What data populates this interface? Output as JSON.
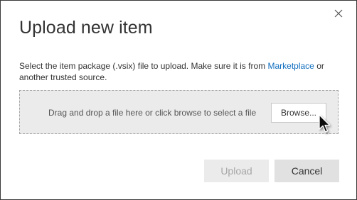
{
  "dialog": {
    "title": "Upload new item",
    "close_icon": "close-icon",
    "description_prefix": "Select the item package (.vsix) file to upload. Make sure it is from ",
    "description_link": "Marketplace",
    "description_suffix": " or another trusted source.",
    "dropzone_text": "Drag and drop a file here or click browse to select a file",
    "browse_label": "Browse...",
    "upload_label": "Upload",
    "cancel_label": "Cancel"
  },
  "colors": {
    "link": "#106ebe",
    "dropzone_bg": "#ebebeb",
    "border": "#3a3a3a"
  }
}
